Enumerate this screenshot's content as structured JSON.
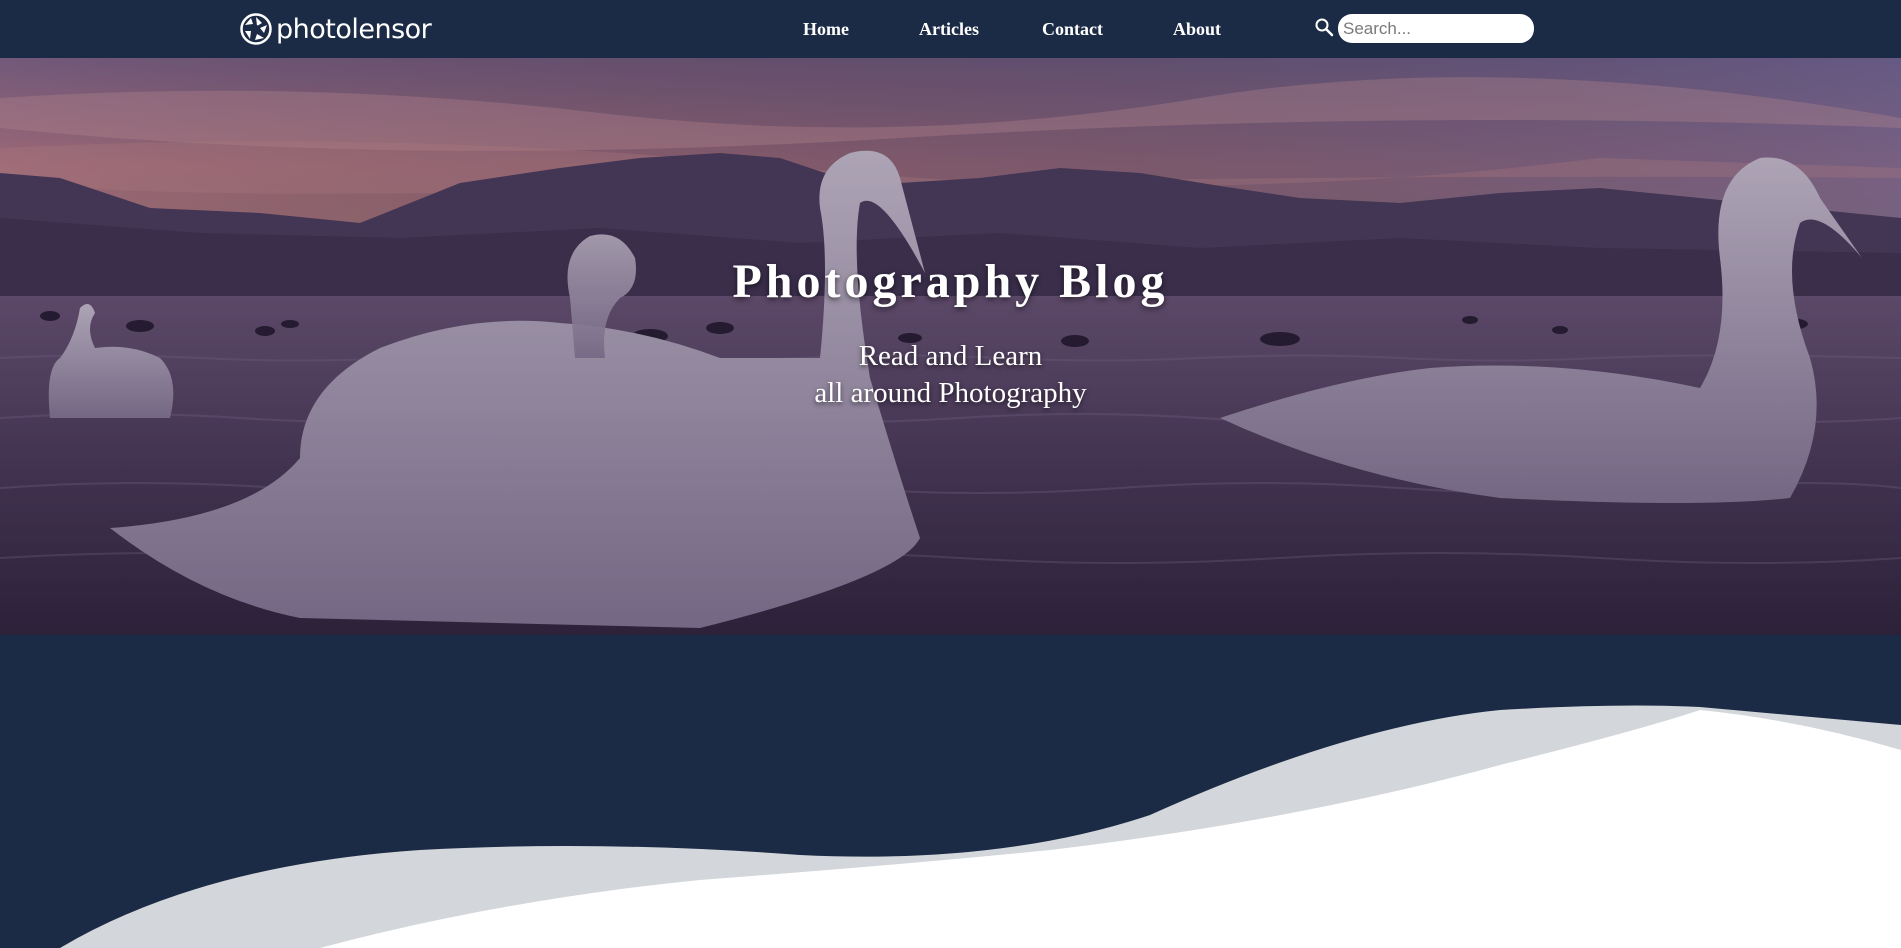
{
  "header": {
    "logo_text": "photolensor",
    "nav": [
      {
        "label": "Home"
      },
      {
        "label": "Articles"
      },
      {
        "label": "Contact"
      },
      {
        "label": "About"
      }
    ],
    "search": {
      "placeholder": "Search...",
      "value": ""
    }
  },
  "hero": {
    "title": "Photography Blog",
    "subtitle_line1": "Read and Learn",
    "subtitle_line2": "all around Photography"
  },
  "colors": {
    "navy": "#1b2a45",
    "wave_gray": "#d3d6da",
    "white": "#ffffff",
    "sky_pink": "#c9848e",
    "sky_purple": "#7a6a96"
  },
  "icons": {
    "logo": "aperture-icon",
    "search": "search-icon"
  }
}
